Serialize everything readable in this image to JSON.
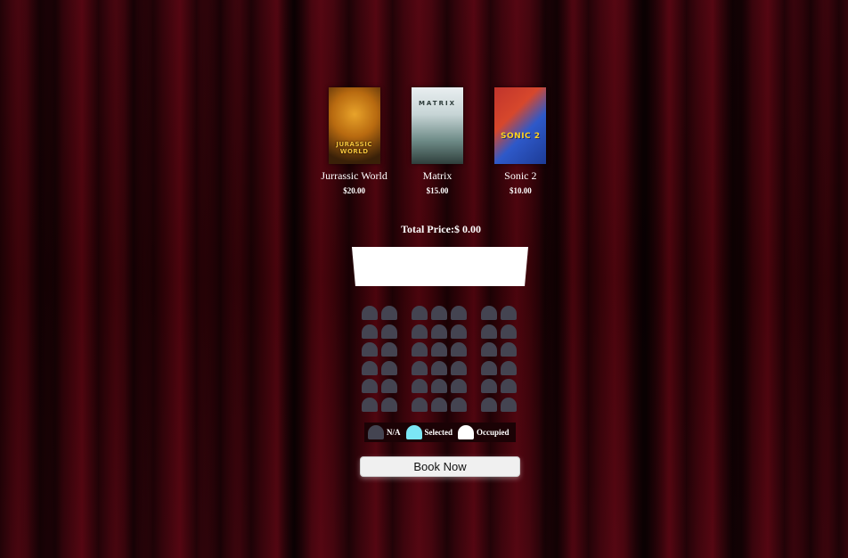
{
  "theme": {
    "curtain": "#3a0309",
    "seat_na": "#444451",
    "seat_selected": "#7be6f5",
    "seat_occupied": "#ffffff",
    "screen": "#ffffff"
  },
  "movies": [
    {
      "title": "Jurrassic World",
      "price": "$20.00",
      "poster_icon": "jurassic-world-poster",
      "poster_caption": "JURASSIC WORLD"
    },
    {
      "title": "Matrix",
      "price": "$15.00",
      "poster_icon": "matrix-poster",
      "poster_caption": "MATRIX"
    },
    {
      "title": "Sonic 2",
      "price": "$10.00",
      "poster_icon": "sonic-2-poster",
      "poster_caption": "SONIC 2"
    }
  ],
  "summary": {
    "total_label": "Total Price:",
    "total_value": "$ 0.00"
  },
  "seating": {
    "rows": 6,
    "left_block_seats": 2,
    "middle_block_seats": 3,
    "right_block_seats": 2,
    "seat_state": "N/A"
  },
  "legend": {
    "na": "N/A",
    "selected": "Selected",
    "occupied": "Occupied"
  },
  "actions": {
    "book_label": "Book Now"
  }
}
